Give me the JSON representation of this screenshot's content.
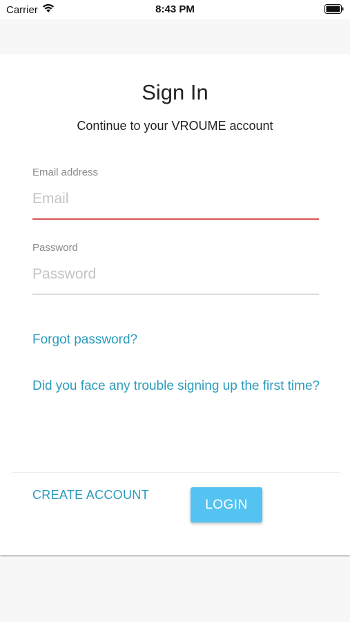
{
  "status_bar": {
    "carrier": "Carrier",
    "time": "8:43 PM",
    "icons": [
      "wifi-icon",
      "battery-icon"
    ]
  },
  "signin": {
    "title": "Sign In",
    "subtitle": "Continue to your VROUME account",
    "email": {
      "label": "Email address",
      "placeholder": "Email",
      "value": ""
    },
    "password": {
      "label": "Password",
      "placeholder": "Password",
      "value": ""
    },
    "forgot_link": "Forgot password?",
    "trouble_link": "Did you face any trouble signing up the first time?",
    "create_account_label": "CREATE ACCOUNT",
    "login_label": "LOGIN"
  },
  "colors": {
    "accent_link": "#2b9bbd",
    "login_button": "#54c3f2",
    "email_underline_error": "#d9534f",
    "password_underline": "#9e9e9e"
  }
}
